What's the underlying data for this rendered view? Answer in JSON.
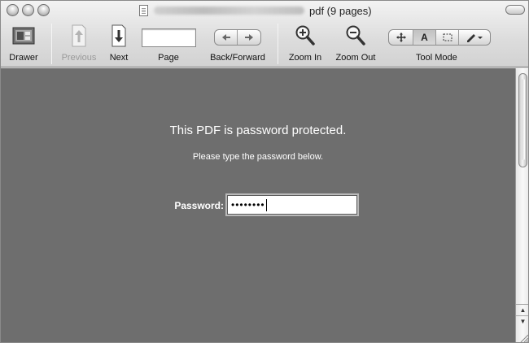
{
  "window": {
    "title": "pdf (9 pages)"
  },
  "toolbar": {
    "drawer_label": "Drawer",
    "previous_label": "Previous",
    "next_label": "Next",
    "page_label": "Page",
    "page_value": "",
    "back_forward_label": "Back/Forward",
    "zoom_in_label": "Zoom In",
    "zoom_out_label": "Zoom Out",
    "tool_mode_label": "Tool Mode",
    "tool_mode_options": [
      "move-icon",
      "A",
      "select-rect-icon",
      "annotate-pen-icon"
    ],
    "tool_mode_selected": "A"
  },
  "content": {
    "message_title": "This PDF is password protected.",
    "message_subtitle": "Please type the password below.",
    "password_label": "Password:",
    "password_value": "••••••••"
  },
  "colors": {
    "content_background": "#6e6e6e",
    "toolbar_background": "#dcdcdc"
  }
}
